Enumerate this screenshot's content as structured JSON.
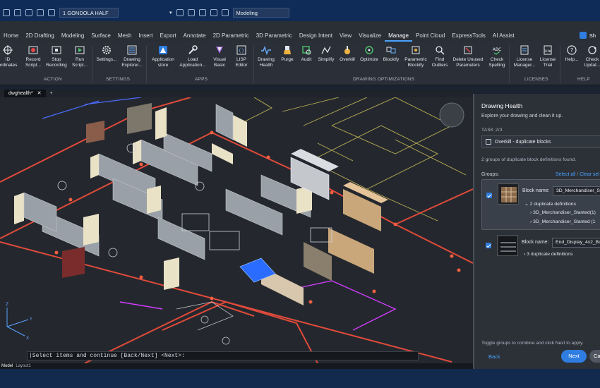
{
  "quick_access": {
    "workspace_dropdown": "1 GONDOLA HALF",
    "visual_style_dropdown": "Modeling"
  },
  "ribbon_tabs": [
    "Home",
    "2D Drafting",
    "Modeling",
    "Surface",
    "Mesh",
    "Insert",
    "Export",
    "Annotate",
    "2D Parametric",
    "3D Parametric",
    "Design Intent",
    "View",
    "Visualize",
    "Manage",
    "Point Cloud",
    "ExpressTools",
    "AI Assist"
  ],
  "active_tab": "Manage",
  "ribbon": {
    "buttons": {
      "id_coordinates": "ID\nordinates",
      "record_script": "Record\nScript...",
      "stop_recording": "Stop\nRecording",
      "run_script": "Run\nScript...",
      "settings": "Settings...",
      "drawing_explorer": "Drawing\nExplorer...",
      "application_store": "Application\nstore",
      "load_application": "Load\nApplication...",
      "visual_basic": "Visual\nBasic",
      "lisp_editor": "LISP\nEditor",
      "drawing_health": "Drawing\nHealth",
      "purge": "Purge",
      "audit": "Audit",
      "simplify": "Simplify",
      "overkill": "Overkill",
      "optimize": "Optimize",
      "blockify": "Blockify",
      "parametric_blockify": "Parametric\nBlockify",
      "find_outliers": "Find\nOutliers",
      "delete_unused_parameters": "Delete Unused\nParameters",
      "check_spelling": "Check\nSpelling",
      "license_manager": "License\nManager...",
      "license_trial": "License\nTrial",
      "help": "Help...",
      "check_updates": "Check\nUpdat..."
    },
    "panels": {
      "action": "ACTION",
      "settings": "SETTINGS",
      "apps": "APPS",
      "drawing_optimizations": "DRAWING OPTIMIZATIONS",
      "licenses": "LICENSES",
      "help": "HELP"
    }
  },
  "doc_tab": "dwghealth*",
  "command_line": "|Select items and continue [Back/Next] <Next>:",
  "status_tabs": [
    "Model",
    "Layout1"
  ],
  "drawing_health_panel": {
    "title": "Drawing Health",
    "subtitle": "Explore your drawing and clean it up.",
    "task_label": "TASK 2/3",
    "task_name": "Overkill - duplicate blocks",
    "found_text": "2 groups of duplicate block definitions found.",
    "groups_label": "Groups:",
    "select_all": "Select all",
    "clear_selection": "Clear sel",
    "block_name_label": "Block name:",
    "group1": {
      "block_name": "3D_Merchandiser_Sla",
      "dup_count": "2 duplicate definitions",
      "defs": [
        "3D_Merchandiser_Slanted(1)",
        "3D_Merchandiser_Slanted (1"
      ]
    },
    "group2": {
      "block_name": "End_Display_4x2_Bot",
      "dup_count": "3 duplicate definitions"
    },
    "hint": "Toggle groups to combine and click Next to apply.",
    "back": "Back",
    "next": "Next",
    "cancel": "Ca"
  },
  "colors": {
    "accent": "#2f7de0",
    "ribbon_bg": "#2b3038",
    "viewport_bg": "#24282e",
    "title_bg": "#0f2b57"
  }
}
